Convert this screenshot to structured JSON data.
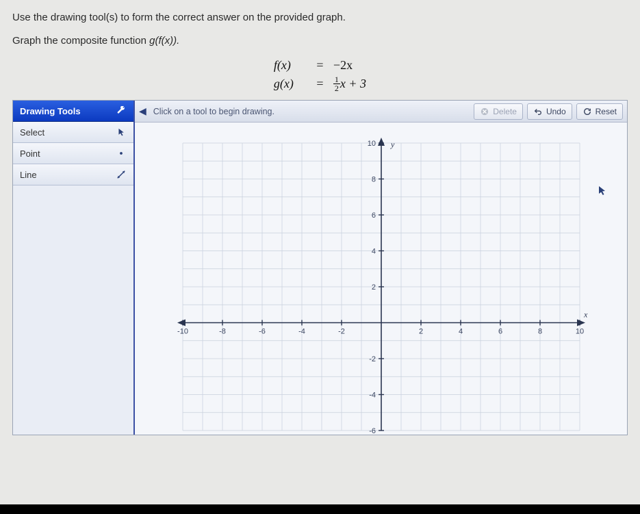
{
  "prompt": {
    "line1": "Use the drawing tool(s) to form the correct answer on the provided graph.",
    "line2_prefix": "Graph the composite function ",
    "line2_func": "g(f(x)).",
    "eq1_fn": "f(x)",
    "eq1_eq": "=",
    "eq1_rhs": "−2x",
    "eq2_fn": "g(x)",
    "eq2_eq": "=",
    "eq2_frac_num": "1",
    "eq2_frac_den": "2",
    "eq2_rest": "x + 3"
  },
  "sidebar": {
    "header": "Drawing Tools",
    "tools": {
      "select": "Select",
      "point": "Point",
      "line": "Line"
    }
  },
  "toolbar": {
    "hint": "Click on a tool to begin drawing.",
    "delete": "Delete",
    "undo": "Undo",
    "reset": "Reset"
  },
  "chart_data": {
    "type": "scatter",
    "title": "",
    "xlabel": "x",
    "ylabel": "y",
    "xlim": [
      -10,
      10
    ],
    "ylim": [
      -6,
      10
    ],
    "xticks": [
      -10,
      -8,
      -6,
      -4,
      -2,
      2,
      4,
      6,
      8,
      10
    ],
    "yticks": [
      -6,
      -4,
      -2,
      2,
      4,
      6,
      8,
      10
    ],
    "grid": true,
    "series": []
  }
}
